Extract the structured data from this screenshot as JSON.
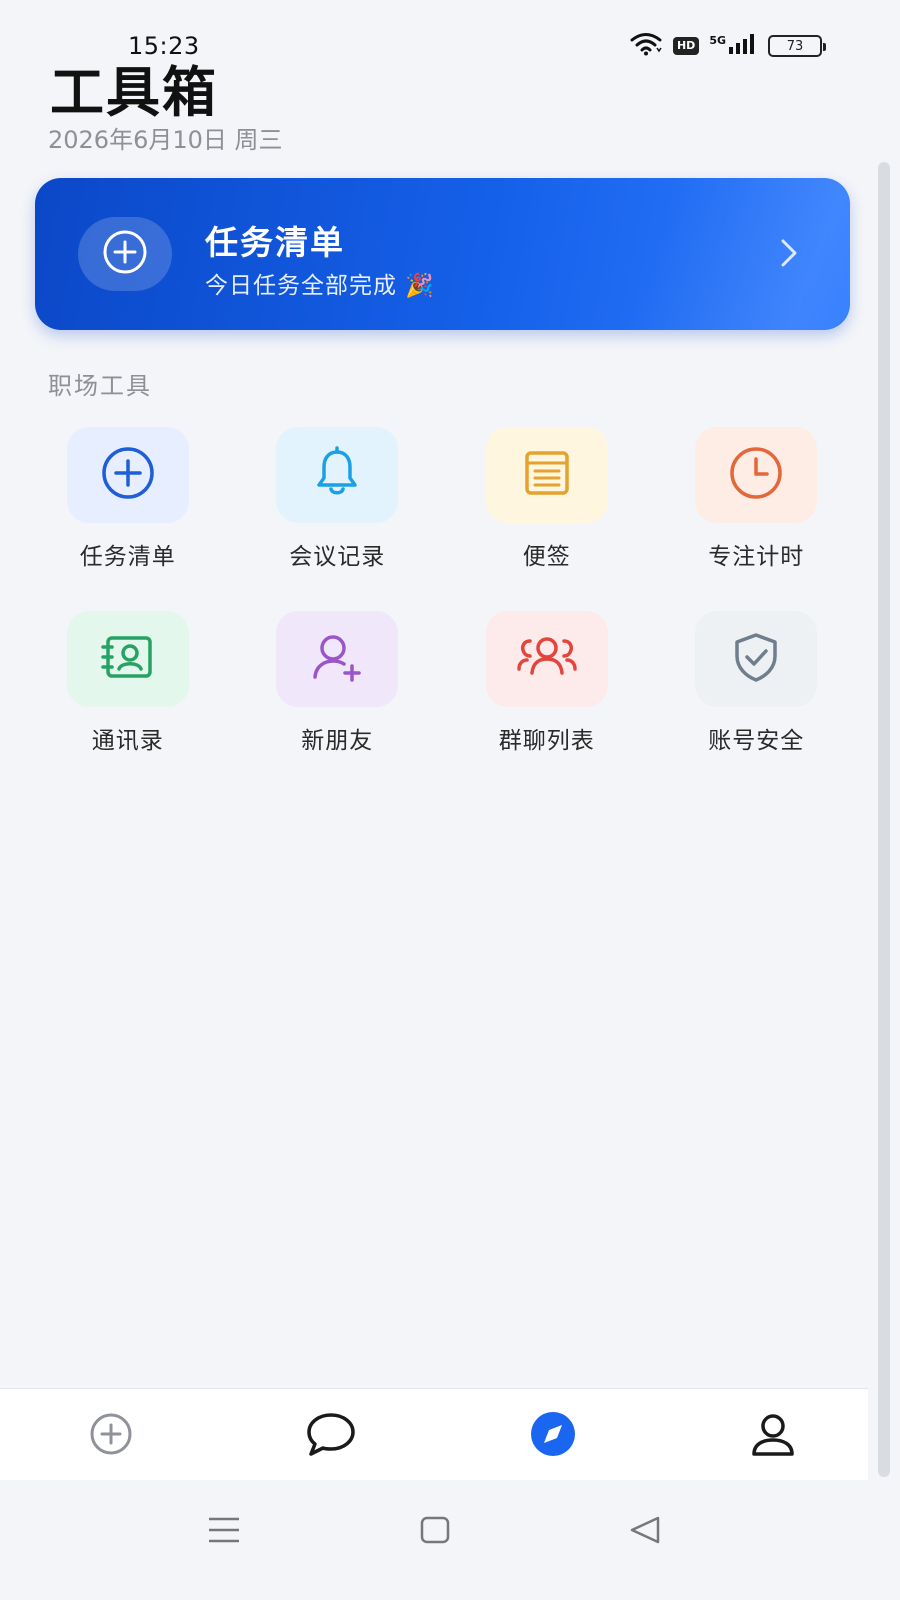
{
  "status_bar": {
    "time": "15:23",
    "network_label": "5G",
    "hd_label": "HD",
    "battery": "73"
  },
  "header": {
    "title": "工具箱",
    "date": "2026年6月10日 周三"
  },
  "banner": {
    "title": "任务清单",
    "subtitle": "今日任务全部完成 🎉",
    "icon": "plus-circle-icon"
  },
  "section": {
    "label": "职场工具"
  },
  "tools": [
    {
      "label": "任务清单",
      "icon": "plus-circle-icon",
      "color": "#1F5FD6",
      "tile": "#E6EEFF"
    },
    {
      "label": "会议记录",
      "icon": "bell-icon",
      "color": "#1AA0E6",
      "tile": "#E3F3FD"
    },
    {
      "label": "便签",
      "icon": "note-icon",
      "color": "#E3A32E",
      "tile": "#FFF6DF"
    },
    {
      "label": "专注计时",
      "icon": "clock-icon",
      "color": "#E4663A",
      "tile": "#FDEDE5"
    },
    {
      "label": "通讯录",
      "icon": "contact-book-icon",
      "color": "#26A364",
      "tile": "#E4F7EC"
    },
    {
      "label": "新朋友",
      "icon": "add-friend-icon",
      "color": "#9A55C9",
      "tile": "#F1E7FB"
    },
    {
      "label": "群聊列表",
      "icon": "group-icon",
      "color": "#E2453C",
      "tile": "#FDEAEA"
    },
    {
      "label": "账号安全",
      "icon": "shield-check-icon",
      "color": "#6E7E8D",
      "tile": "#EEF1F4"
    }
  ],
  "bottom_nav": [
    {
      "icon": "plus-circle-icon",
      "active": false
    },
    {
      "icon": "chat-icon",
      "active": false
    },
    {
      "icon": "compass-icon",
      "active": true
    },
    {
      "icon": "user-icon",
      "active": false
    }
  ],
  "colors": {
    "accent": "#1A66F0",
    "background": "#F3F5F9"
  }
}
